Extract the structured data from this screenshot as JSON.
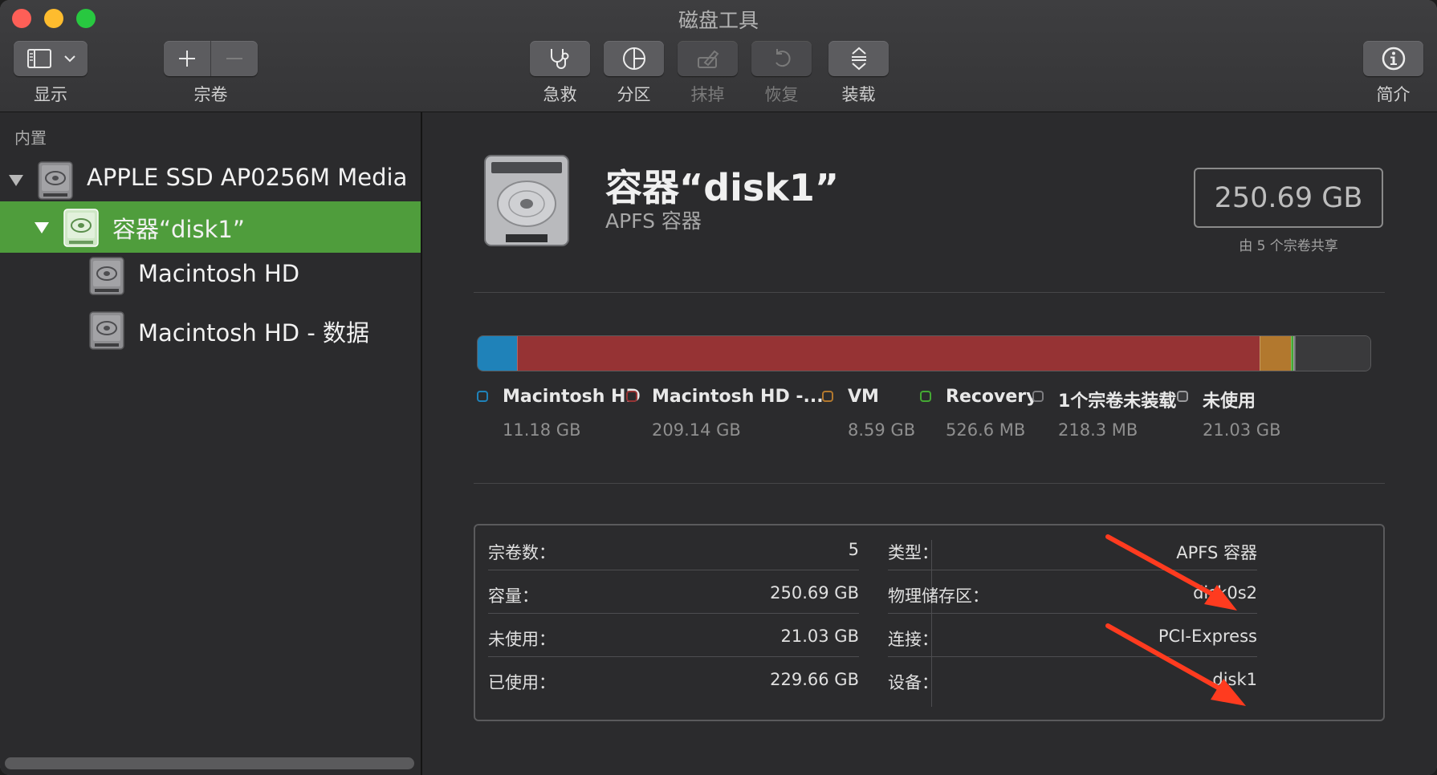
{
  "window": {
    "title": "磁盘工具"
  },
  "toolbar": {
    "view_label": "显示",
    "volume_label": "宗卷",
    "first_aid_label": "急救",
    "partition_label": "分区",
    "erase_label": "抹掉",
    "restore_label": "恢复",
    "mount_label": "装载",
    "info_label": "简介"
  },
  "sidebar": {
    "section": "内置",
    "items": [
      {
        "label": "APPLE SSD AP0256M Media",
        "icon": "internal-disk-icon"
      },
      {
        "label": "容器“disk1”",
        "icon": "container-disk-icon",
        "selected": true
      },
      {
        "label": "Macintosh HD",
        "icon": "volume-disk-icon"
      },
      {
        "label": "Macintosh HD - 数据",
        "icon": "volume-disk-icon"
      }
    ]
  },
  "detail": {
    "title": "容器“disk1”",
    "subtitle": "APFS 容器",
    "capacity": "250.69 GB",
    "capacity_caption": "由 5 个宗卷共享"
  },
  "usage": {
    "segments": [
      {
        "name": "Macintosh HD",
        "size": "11.18 GB",
        "gb": 11.18,
        "color": "#1f82b9"
      },
      {
        "name": "Macintosh HD -...",
        "size": "209.14 GB",
        "gb": 209.14,
        "color": "#963334"
      },
      {
        "name": "VM",
        "size": "8.59 GB",
        "gb": 8.59,
        "color": "#b2782e"
      },
      {
        "name": "Recovery",
        "size": "526.6 MB",
        "gb": 0.53,
        "color": "#44a833"
      },
      {
        "name": "1个宗卷未装载",
        "size": "218.3 MB",
        "gb": 0.22,
        "color": "#7d7d80"
      },
      {
        "name": "未使用",
        "size": "21.03 GB",
        "gb": 21.03,
        "color": "#3a3a3c"
      }
    ]
  },
  "info": {
    "left": [
      {
        "key": "宗卷数：",
        "value": "5"
      },
      {
        "key": "容量：",
        "value": "250.69 GB"
      },
      {
        "key": "未使用：",
        "value": "21.03 GB"
      },
      {
        "key": "已使用：",
        "value": "229.66 GB"
      }
    ],
    "right": [
      {
        "key": "类型：",
        "value": "APFS 容器"
      },
      {
        "key": "物理储存区：",
        "value": "disk0s2"
      },
      {
        "key": "连接：",
        "value": "PCI-Express"
      },
      {
        "key": "设备：",
        "value": "disk1"
      }
    ]
  },
  "colors": {
    "selection": "#4f9d3c",
    "annotation_arrow": "#ff3b1f"
  }
}
